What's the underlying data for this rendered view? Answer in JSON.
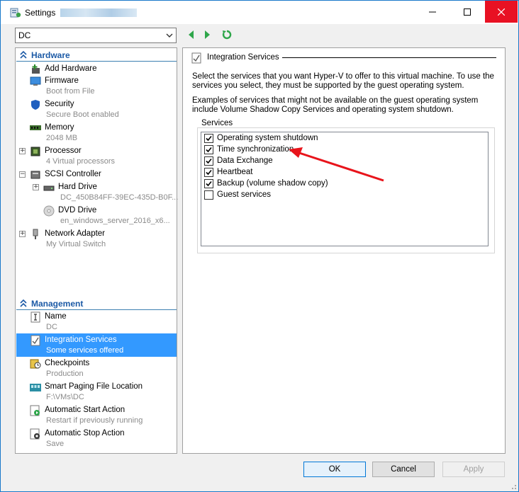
{
  "window": {
    "title": "Settings",
    "accent": "#1979ca",
    "close_color": "#e81123",
    "controls": [
      "minimize-icon",
      "maximize-icon",
      "close-icon"
    ]
  },
  "toolbar": {
    "vm_select": "DC",
    "back_icon": "green-left-arrow-icon",
    "forward_icon": "green-right-arrow-icon",
    "refresh_icon": "refresh-icon"
  },
  "sidebar": {
    "hardware_heading": "Hardware",
    "management_heading": "Management",
    "hardware": [
      {
        "label": "Add Hardware",
        "sub": "",
        "icon": "add-hardware-icon"
      },
      {
        "label": "Firmware",
        "sub": "Boot from File",
        "icon": "firmware-icon"
      },
      {
        "label": "Security",
        "sub": "Secure Boot enabled",
        "icon": "shield-icon"
      },
      {
        "label": "Memory",
        "sub": "2048 MB",
        "icon": "memory-icon"
      },
      {
        "label": "Processor",
        "sub": "4 Virtual processors",
        "icon": "processor-icon"
      },
      {
        "label": "SCSI Controller",
        "sub": "",
        "icon": "scsi-icon"
      },
      {
        "label": "Hard Drive",
        "sub": "DC_450B84FF-39EC-435D-B0F...",
        "icon": "hard-drive-icon"
      },
      {
        "label": "DVD Drive",
        "sub": "en_windows_server_2016_x6...",
        "icon": "dvd-icon"
      },
      {
        "label": "Network Adapter",
        "sub": "My Virtual Switch",
        "icon": "network-adapter-icon"
      }
    ],
    "management": [
      {
        "label": "Name",
        "sub": "DC",
        "icon": "name-icon"
      },
      {
        "label": "Integration Services",
        "sub": "Some services offered",
        "icon": "integration-services-icon"
      },
      {
        "label": "Checkpoints",
        "sub": "Production",
        "icon": "checkpoints-icon"
      },
      {
        "label": "Smart Paging File Location",
        "sub": "F:\\VMs\\DC",
        "icon": "smart-paging-icon"
      },
      {
        "label": "Automatic Start Action",
        "sub": "Restart if previously running",
        "icon": "auto-start-icon"
      },
      {
        "label": "Automatic Stop Action",
        "sub": "Save",
        "icon": "auto-stop-icon"
      }
    ],
    "selected": "Integration Services",
    "selection_color": "#3399ff"
  },
  "main": {
    "title": "Integration Services",
    "intro": "Select the services that you want Hyper-V to offer to this virtual machine. To use the services you select, they must be supported by the guest operating system.",
    "examples": "Examples of services that might not be available on the guest operating system include Volume Shadow Copy Services and operating system shutdown.",
    "services_label": "Services",
    "services": [
      {
        "label": "Operating system shutdown",
        "checked": true
      },
      {
        "label": "Time synchronization",
        "checked": true
      },
      {
        "label": "Data Exchange",
        "checked": true
      },
      {
        "label": "Heartbeat",
        "checked": true
      },
      {
        "label": "Backup (volume shadow copy)",
        "checked": true
      },
      {
        "label": "Guest services",
        "checked": false
      }
    ],
    "annotation_color": "#e8141b"
  },
  "buttons": {
    "ok": "OK",
    "cancel": "Cancel",
    "apply": "Apply"
  }
}
